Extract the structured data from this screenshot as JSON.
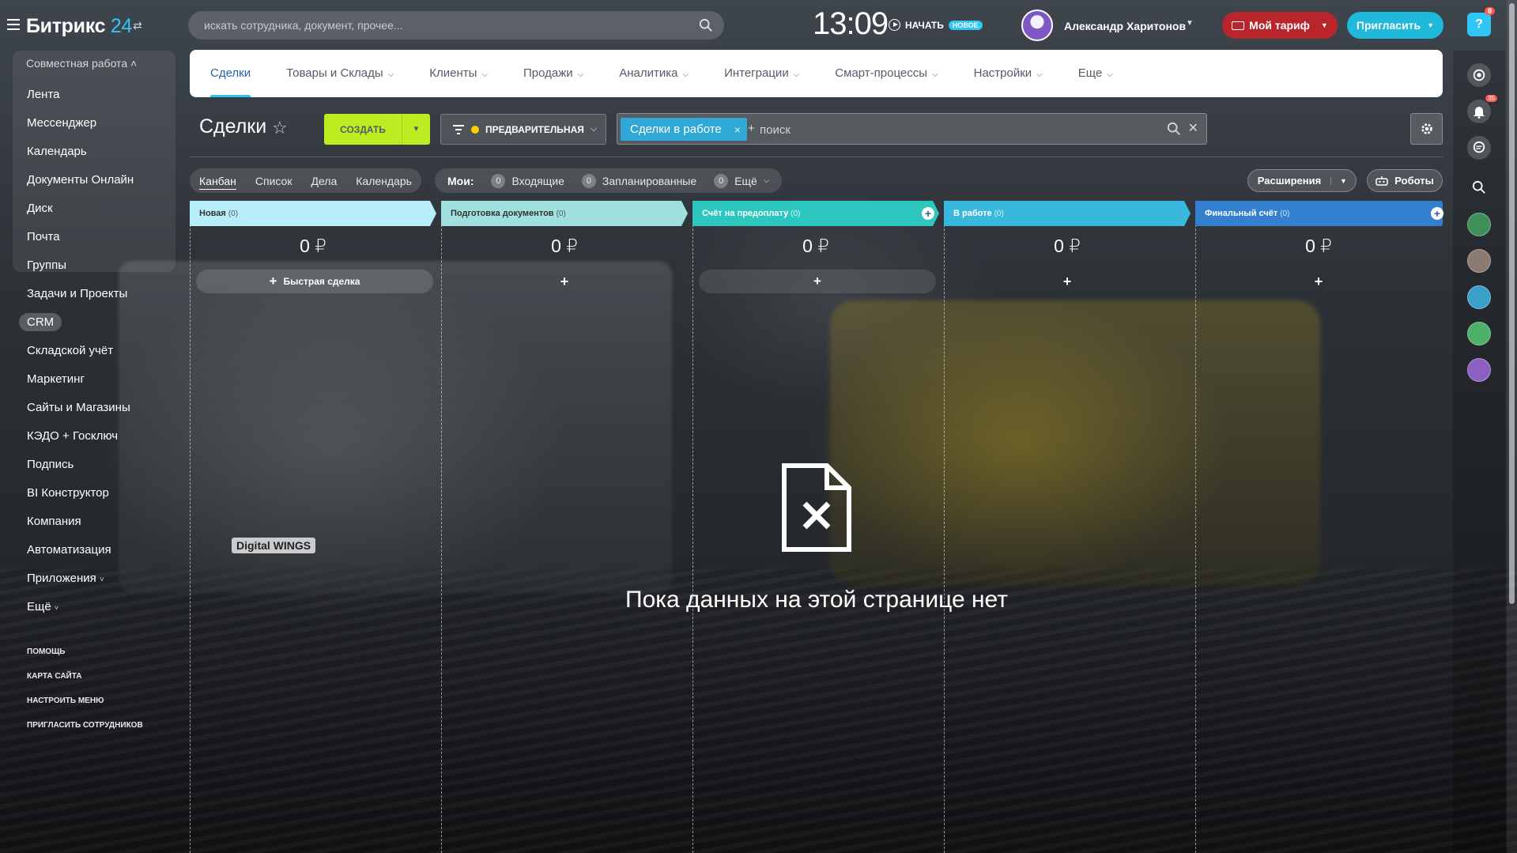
{
  "header": {
    "logo_text": "Битрикс",
    "logo_number": "24",
    "search_placeholder": "искать сотрудника, документ, прочее...",
    "clock": "13:09",
    "start_label": "НАЧАТЬ",
    "start_badge": "НОВОЕ",
    "user_name": "Александр Харитонов",
    "tariff_label": "Мой тариф",
    "invite_label": "Пригласить",
    "help_count": "8"
  },
  "sidebar": {
    "group_title": "Совместная работа",
    "items": [
      {
        "label": "Лента"
      },
      {
        "label": "Мессенджер"
      },
      {
        "label": "Календарь"
      },
      {
        "label": "Документы Онлайн"
      },
      {
        "label": "Диск"
      },
      {
        "label": "Почта"
      },
      {
        "label": "Группы"
      },
      {
        "label": "Задачи и Проекты"
      },
      {
        "label": "CRM"
      },
      {
        "label": "Складской учёт"
      },
      {
        "label": "Маркетинг"
      },
      {
        "label": "Сайты и Магазины"
      },
      {
        "label": "КЭДО + Госключ"
      },
      {
        "label": "Подпись"
      },
      {
        "label": "BI Конструктор"
      },
      {
        "label": "Компания"
      },
      {
        "label": "Автоматизация"
      },
      {
        "label": "Приложения"
      },
      {
        "label": "Ещё"
      }
    ],
    "footer_links": [
      "ПОМОЩЬ",
      "КАРТА САЙТА",
      "НАСТРОИТЬ МЕНЮ",
      "ПРИГЛАСИТЬ СОТРУДНИКОВ"
    ]
  },
  "nav": {
    "tabs": [
      {
        "label": "Сделки"
      },
      {
        "label": "Товары и Склады"
      },
      {
        "label": "Клиенты"
      },
      {
        "label": "Продажи"
      },
      {
        "label": "Аналитика"
      },
      {
        "label": "Интеграции"
      },
      {
        "label": "Смарт-процессы"
      },
      {
        "label": "Настройки"
      },
      {
        "label": "Еще"
      }
    ],
    "active_index": 0
  },
  "toolbar": {
    "title": "Сделки",
    "create_label": "СОЗДАТЬ",
    "funnel_label": "ПРЕДВАРИТЕЛЬНАЯ",
    "filter_chip": "Сделки в работе",
    "filter_plus": "+",
    "filter_placeholder": "поиск"
  },
  "views": {
    "items": [
      "Канбан",
      "Список",
      "Дела",
      "Календарь"
    ],
    "active_index": 0,
    "my_label": "Мои:",
    "counters": [
      {
        "count": "0",
        "label": "Входящие"
      },
      {
        "count": "0",
        "label": "Запланированные"
      },
      {
        "count": "0",
        "label": "Ещё"
      }
    ],
    "extensions_label": "Расширения",
    "robots_label": "Роботы"
  },
  "kanban": {
    "quick_deal_label": "Быстрая сделка",
    "columns": [
      {
        "title": "Новая",
        "count": "(0)",
        "sum": "0 ₽",
        "color": "#b8eefa"
      },
      {
        "title": "Подготовка документов",
        "count": "(0)",
        "sum": "0 ₽",
        "color": "#a0e1e0"
      },
      {
        "title": "Счёт на предоплату",
        "count": "(0)",
        "sum": "0 ₽",
        "color": "#2ec7c0"
      },
      {
        "title": "В работе",
        "count": "(0)",
        "sum": "0 ₽",
        "color": "#39b8dd"
      },
      {
        "title": "Финальный счёт",
        "count": "(0)",
        "sum": "0 ₽",
        "color": "#3380d1"
      }
    ]
  },
  "empty_state": {
    "text": "Пока данных на этой странице нет"
  },
  "background": {
    "truck_label": "Digital WINGS"
  },
  "right_bar": {
    "notifications_count": "35"
  }
}
